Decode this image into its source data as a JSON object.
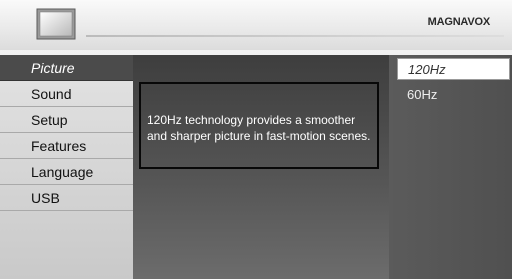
{
  "header": {
    "brand": "MAGNAVOX",
    "icon": "tv-icon"
  },
  "menu": {
    "items": [
      {
        "label": "Picture",
        "selected": true
      },
      {
        "label": "Sound",
        "selected": false
      },
      {
        "label": "Setup",
        "selected": false
      },
      {
        "label": "Features",
        "selected": false
      },
      {
        "label": "Language",
        "selected": false
      },
      {
        "label": "USB",
        "selected": false
      }
    ]
  },
  "info": {
    "text": "120Hz technology provides a smoother and sharper picture in fast-motion scenes."
  },
  "options": [
    {
      "label": "120Hz",
      "selected": true
    },
    {
      "label": "60Hz",
      "selected": false
    }
  ],
  "colors": {
    "menu_selected_bg": "#4b4b4b",
    "panel_dark": "#3e3e3e",
    "option_selected_bg": "#ffffff"
  }
}
